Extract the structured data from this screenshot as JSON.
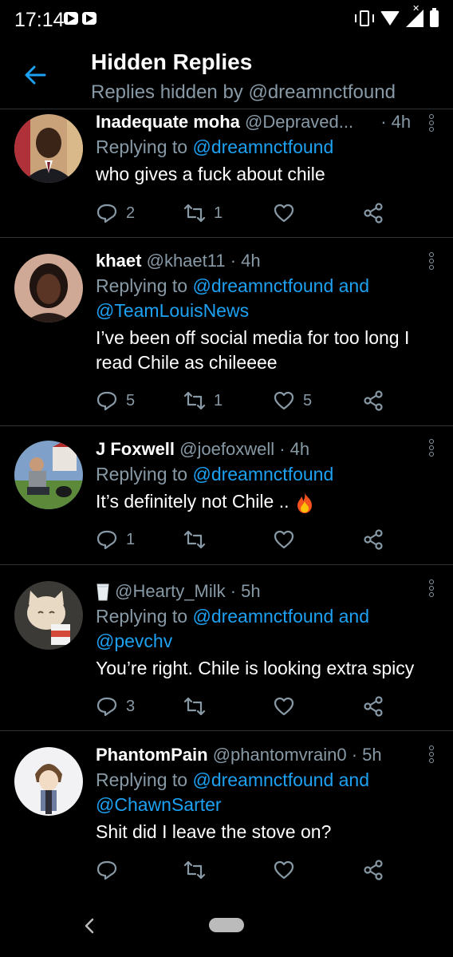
{
  "status_bar": {
    "time": "17:14"
  },
  "header": {
    "title": "Hidden Replies",
    "subtitle": "Replies hidden by @dreamnctfound"
  },
  "tweets": [
    {
      "name": "Inadequate moha",
      "handle": "@Depraved...",
      "time": "· 4h",
      "replying_prefix": "Replying to",
      "replying_to": "@dreamnctfound",
      "replying_and": "",
      "replying_second": "",
      "text": "who gives a fuck about chile",
      "replies": "2",
      "retweets": "1",
      "likes": ""
    },
    {
      "name": "khaet",
      "handle": "@khaet11",
      "time": "· 4h",
      "replying_prefix": "Replying to",
      "replying_to": "@dreamnctfound",
      "replying_and": "and",
      "replying_second": "@TeamLouisNews",
      "text": "I’ve been off social media for too long I read Chile as chileeee",
      "replies": "5",
      "retweets": "1",
      "likes": "5"
    },
    {
      "name": "J Foxwell",
      "handle": "@joefoxwell",
      "time": "· 4h",
      "replying_prefix": "Replying to",
      "replying_to": "@dreamnctfound",
      "replying_and": "",
      "replying_second": "",
      "text": "It’s definitely not Chile ..",
      "emoji": "fire-emoji",
      "replies": "1",
      "retweets": "",
      "likes": ""
    },
    {
      "name": "",
      "name_emoji": "milk-glass-emoji",
      "handle": "@Hearty_Milk",
      "time": "· 5h",
      "replying_prefix": "Replying to",
      "replying_to": "@dreamnctfound",
      "replying_and": "and",
      "replying_second": "@pevchv",
      "text": "You’re right. Chile is looking extra spicy",
      "replies": "3",
      "retweets": "",
      "likes": ""
    },
    {
      "name": "PhantomPain",
      "handle": "@phantomvrain0",
      "time": "· 5h",
      "replying_prefix": "Replying to",
      "replying_to": "@dreamnctfound",
      "replying_and": "and",
      "replying_second": "@ChawnSarter",
      "text": "Shit did I leave the stove on?",
      "replies": "",
      "retweets": "",
      "likes": ""
    }
  ],
  "icons": {
    "back": "arrow-left-icon",
    "reply": "reply-icon",
    "retweet": "retweet-icon",
    "like": "heart-icon",
    "share": "share-icon",
    "more": "more-vertical-icon"
  },
  "colors": {
    "background": "#000000",
    "accent": "#1da1f2",
    "secondary_text": "#8899a6",
    "divider": "#2f3336"
  }
}
